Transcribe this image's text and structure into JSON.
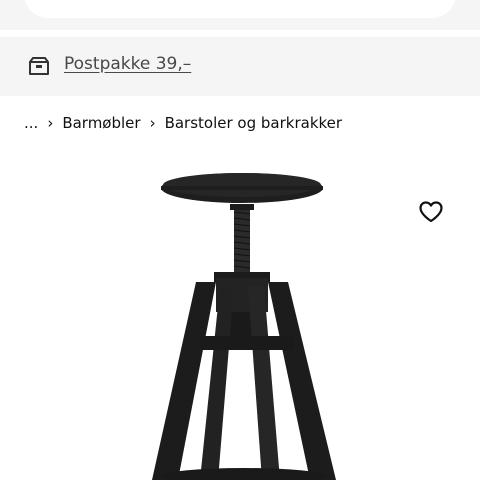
{
  "shipping": {
    "label": "Postpakke 39,–",
    "icon": "delivery-box-icon"
  },
  "breadcrumb": {
    "ellipsis": "...",
    "items": [
      {
        "label": "Barmøbler"
      },
      {
        "label": "Barstoler og barkrakker"
      }
    ],
    "separator_icon": "chevron-right-icon"
  },
  "favorite": {
    "icon": "heart-outline-icon"
  },
  "product": {
    "image": "bar-stool-black"
  },
  "colors": {
    "banner_bg": "#f5f5f5",
    "stool": "#1c1c1c",
    "link_text": "#484848"
  }
}
